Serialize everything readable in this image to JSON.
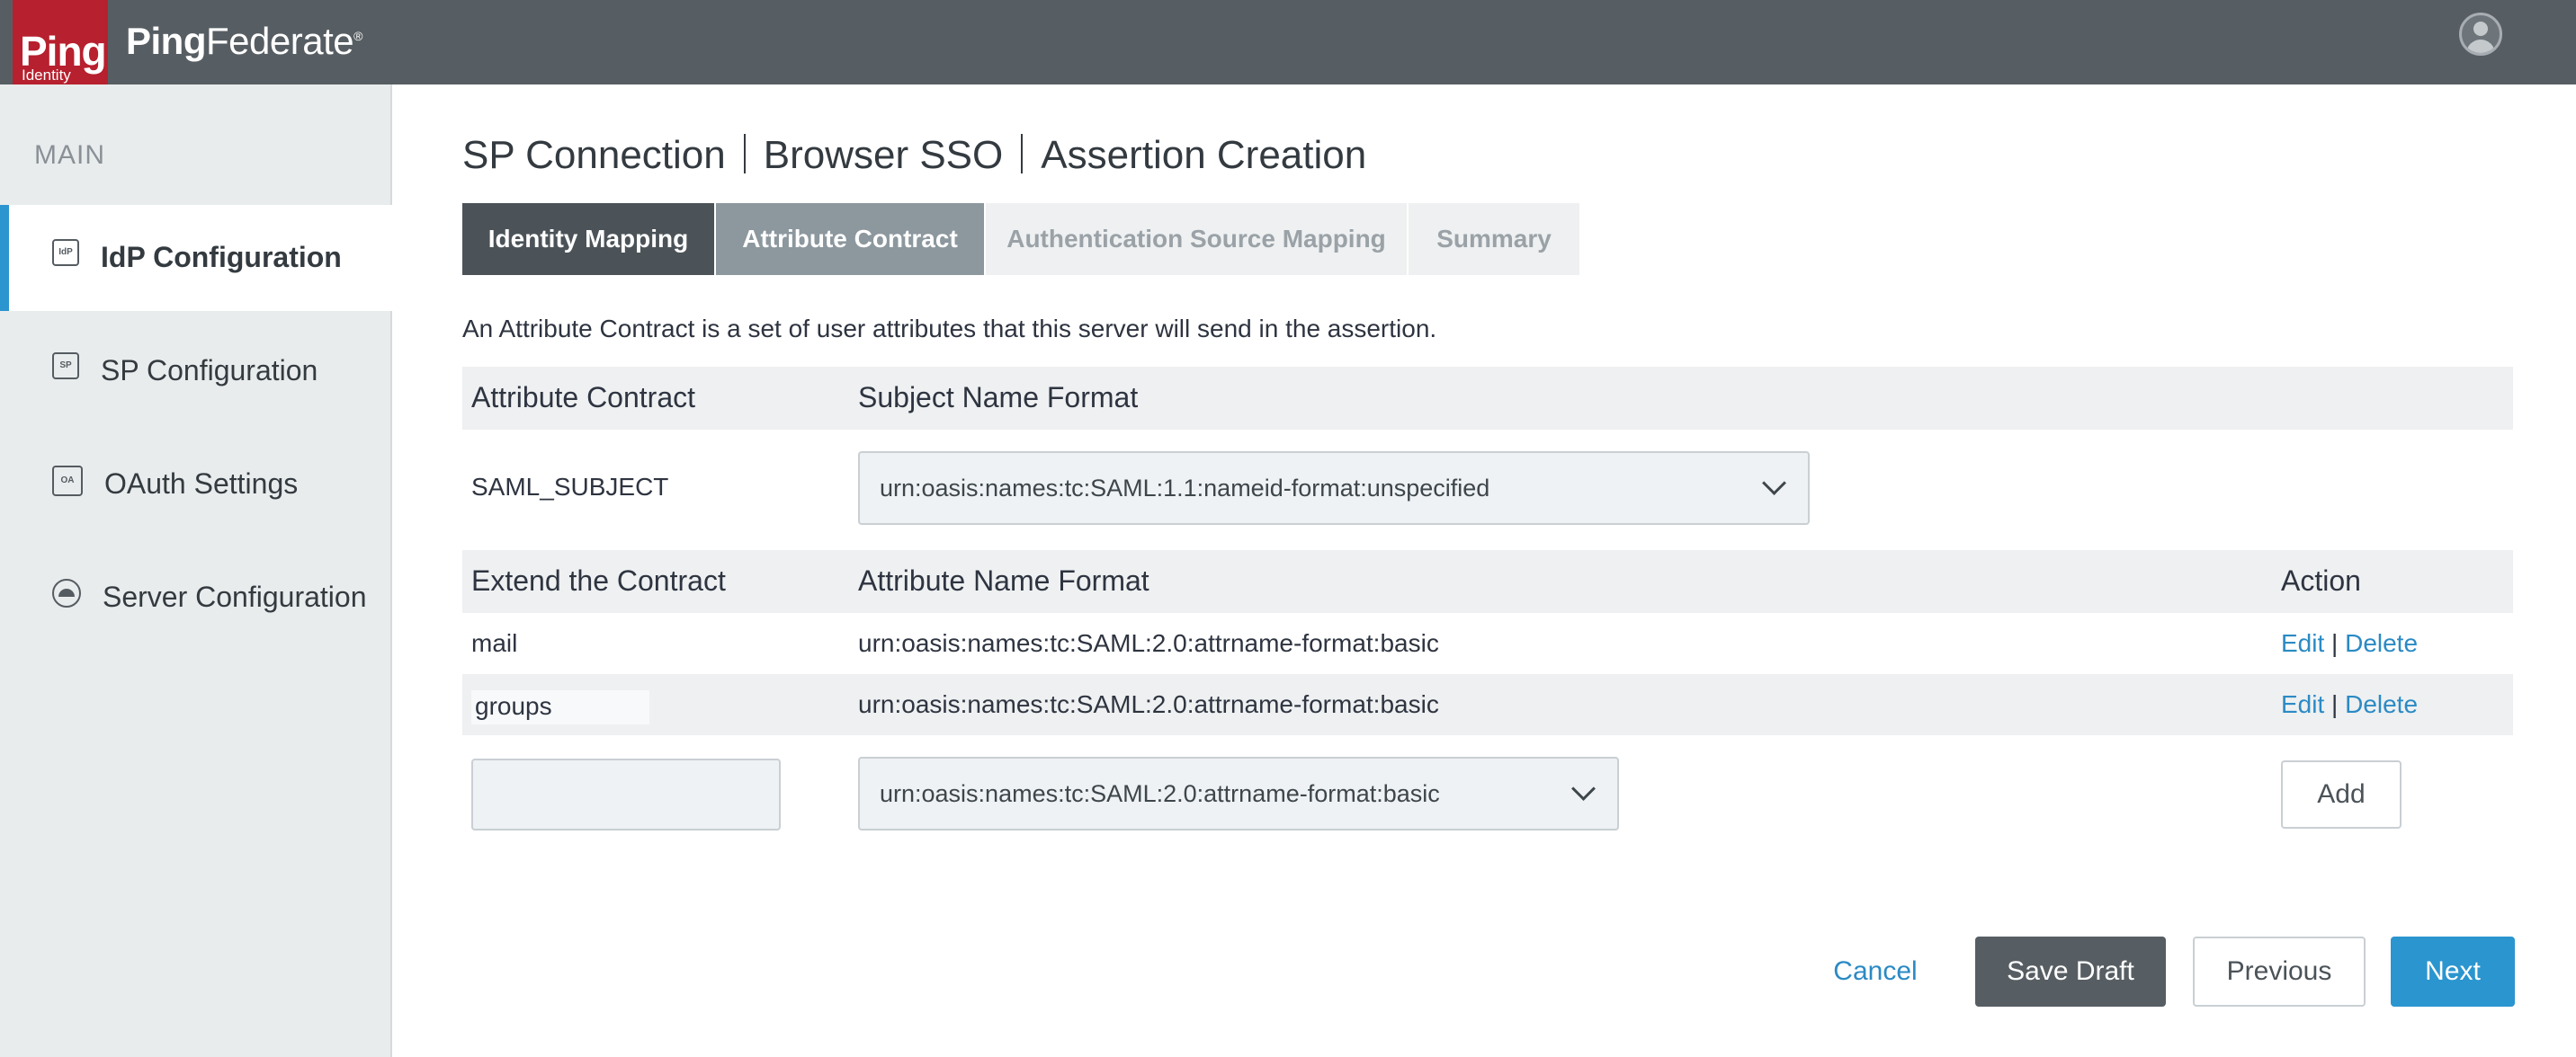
{
  "brand": {
    "logo_word": "Ping",
    "logo_sub": "Identity",
    "product_bold": "Ping",
    "product_rest": "Federate",
    "registered_mark": "®"
  },
  "sidebar": {
    "heading": "MAIN",
    "items": [
      {
        "label": "IdP Configuration",
        "icon": "idp-icon",
        "icon_text": "IdP",
        "active": true
      },
      {
        "label": "SP Configuration",
        "icon": "sp-icon",
        "icon_text": "SP",
        "active": false
      },
      {
        "label": "OAuth Settings",
        "icon": "oauth-icon",
        "icon_text": "OA",
        "active": false
      },
      {
        "label": "Server Configuration",
        "icon": "server-icon",
        "icon_text": "",
        "active": false
      }
    ]
  },
  "breadcrumb": [
    "SP Connection",
    "Browser SSO",
    "Assertion Creation"
  ],
  "tabs": [
    {
      "label": "Identity Mapping",
      "state": "completed"
    },
    {
      "label": "Attribute Contract",
      "state": "current"
    },
    {
      "label": "Authentication Source Mapping",
      "state": "disabled"
    },
    {
      "label": "Summary",
      "state": "disabled"
    }
  ],
  "intro": "An Attribute Contract is a set of user attributes that this server will send in the assertion.",
  "contract_table": {
    "headers": [
      "Attribute Contract",
      "Subject Name Format"
    ],
    "row": {
      "attribute": "SAML_SUBJECT",
      "format": "urn:oasis:names:tc:SAML:1.1:nameid-format:unspecified"
    }
  },
  "extend_table": {
    "headers": [
      "Extend the Contract",
      "Attribute Name Format",
      "Action"
    ],
    "rows": [
      {
        "name": "mail",
        "format": "urn:oasis:names:tc:SAML:2.0:attrname-format:basic",
        "edit": "Edit",
        "sep": "|",
        "delete": "Delete"
      },
      {
        "name": "groups",
        "format": "urn:oasis:names:tc:SAML:2.0:attrname-format:basic",
        "edit": "Edit",
        "sep": "|",
        "delete": "Delete"
      }
    ],
    "new_row": {
      "name_value": "",
      "format_value": "urn:oasis:names:tc:SAML:2.0:attrname-format:basic",
      "add_label": "Add"
    }
  },
  "footer": {
    "cancel": "Cancel",
    "save_draft": "Save Draft",
    "previous": "Previous",
    "next": "Next"
  },
  "colors": {
    "topbar": "#575e63",
    "brand_red": "#b7202e",
    "accent_blue": "#2b95cf",
    "tab_active": "#4b5358",
    "tab_current": "#8c979e"
  }
}
